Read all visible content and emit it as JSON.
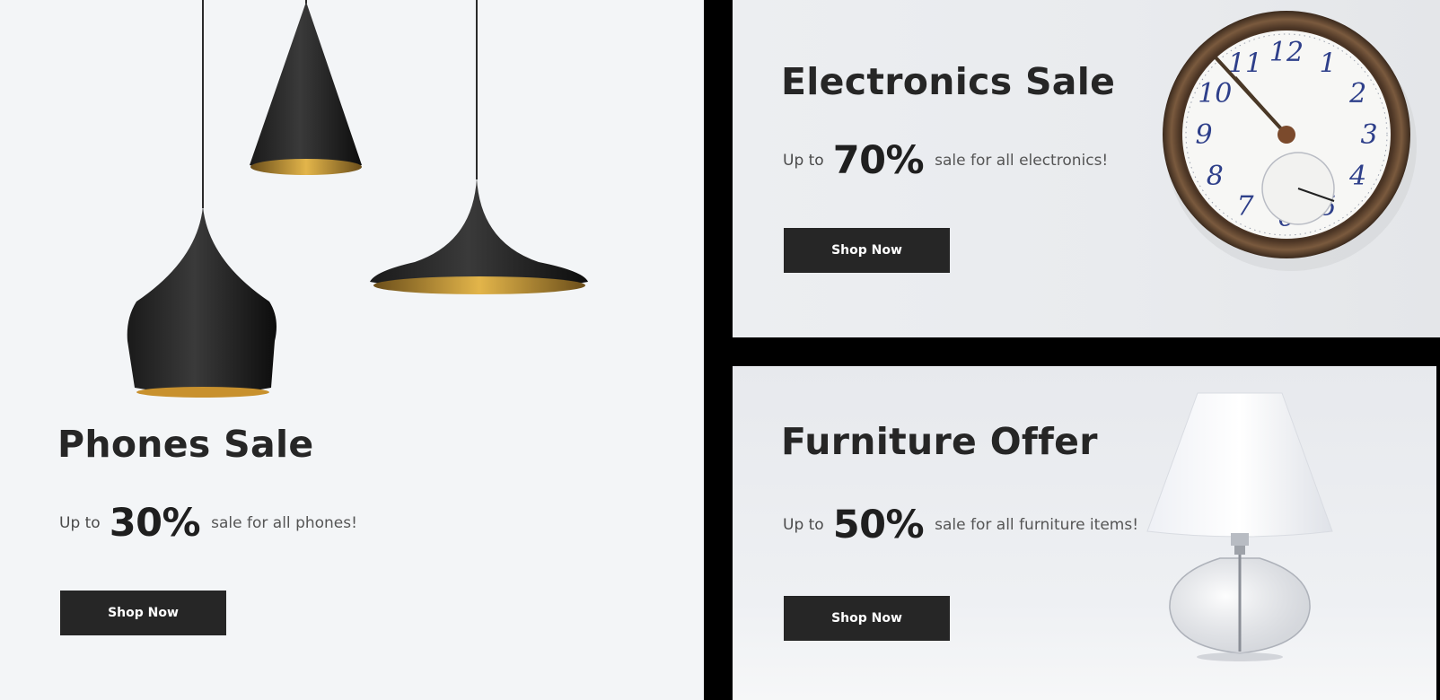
{
  "banners": {
    "phones": {
      "title": "Phones Sale",
      "prefix": "Up to",
      "percent": "30%",
      "suffix": "sale for all phones!",
      "button": "Shop Now"
    },
    "electronics": {
      "title": "Electronics Sale",
      "prefix": "Up to",
      "percent": "70%",
      "suffix": "sale for all electronics!",
      "button": "Shop Now"
    },
    "furniture": {
      "title": "Furniture Offer",
      "prefix": "Up to",
      "percent": "50%",
      "suffix": "sale for all furniture items!",
      "button": "Shop Now"
    }
  },
  "clock_numerals": [
    "12",
    "1",
    "2",
    "3",
    "4",
    "5",
    "6",
    "7",
    "8",
    "9",
    "10",
    "11"
  ],
  "colors": {
    "button_bg": "#262626",
    "button_text": "#ffffff",
    "heading": "#262626",
    "panel_bg": "#f3f5f7"
  }
}
